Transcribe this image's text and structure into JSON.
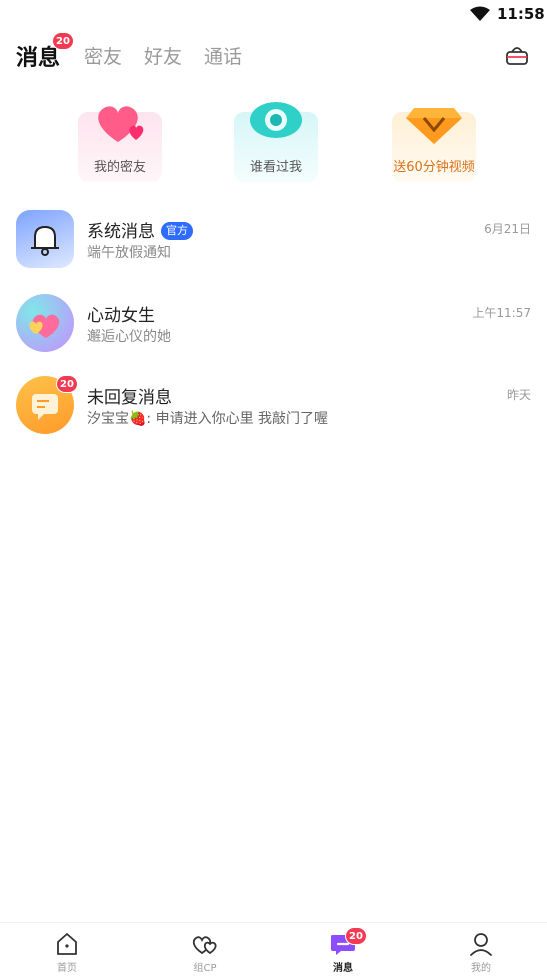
{
  "status_bar": {
    "time": "11:58",
    "wifi_icon": "wifi-icon"
  },
  "header": {
    "tabs": [
      {
        "label": "消息",
        "badge": "20",
        "active": true
      },
      {
        "label": "密友"
      },
      {
        "label": "好友"
      },
      {
        "label": "通话"
      }
    ],
    "basket_icon": "basket-icon"
  },
  "features": [
    {
      "label": "我的密友",
      "icon": "heart-icon"
    },
    {
      "label": "谁看过我",
      "icon": "eye-icon"
    },
    {
      "label": "送60分钟视频",
      "icon": "diamond-icon"
    }
  ],
  "messages": [
    {
      "title": "系统消息",
      "tag": "官方",
      "subtitle": "端午放假通知",
      "time": "6月21日",
      "icon": "bell-icon"
    },
    {
      "title": "心动女生",
      "subtitle": "邂逅心仪的她",
      "time": "上午11:57",
      "icon": "heart-icon"
    },
    {
      "title": "未回复消息",
      "subtitle": "汐宝宝🍓: 申请进入你心里 我敲门了喔",
      "time": "昨天",
      "badge": "20",
      "icon": "chat-icon"
    }
  ],
  "bottom_nav": [
    {
      "label": "首页",
      "icon": "home-icon"
    },
    {
      "label": "组CP",
      "icon": "couple-hearts-icon"
    },
    {
      "label": "消息",
      "icon": "message-icon",
      "badge": "20",
      "active": true
    },
    {
      "label": "我的",
      "icon": "profile-icon"
    }
  ],
  "colors": {
    "badge": "#f23a52",
    "official_tag": "#2e6bff",
    "gold_text": "#d9731a",
    "active_nav": "#8b4dff"
  }
}
